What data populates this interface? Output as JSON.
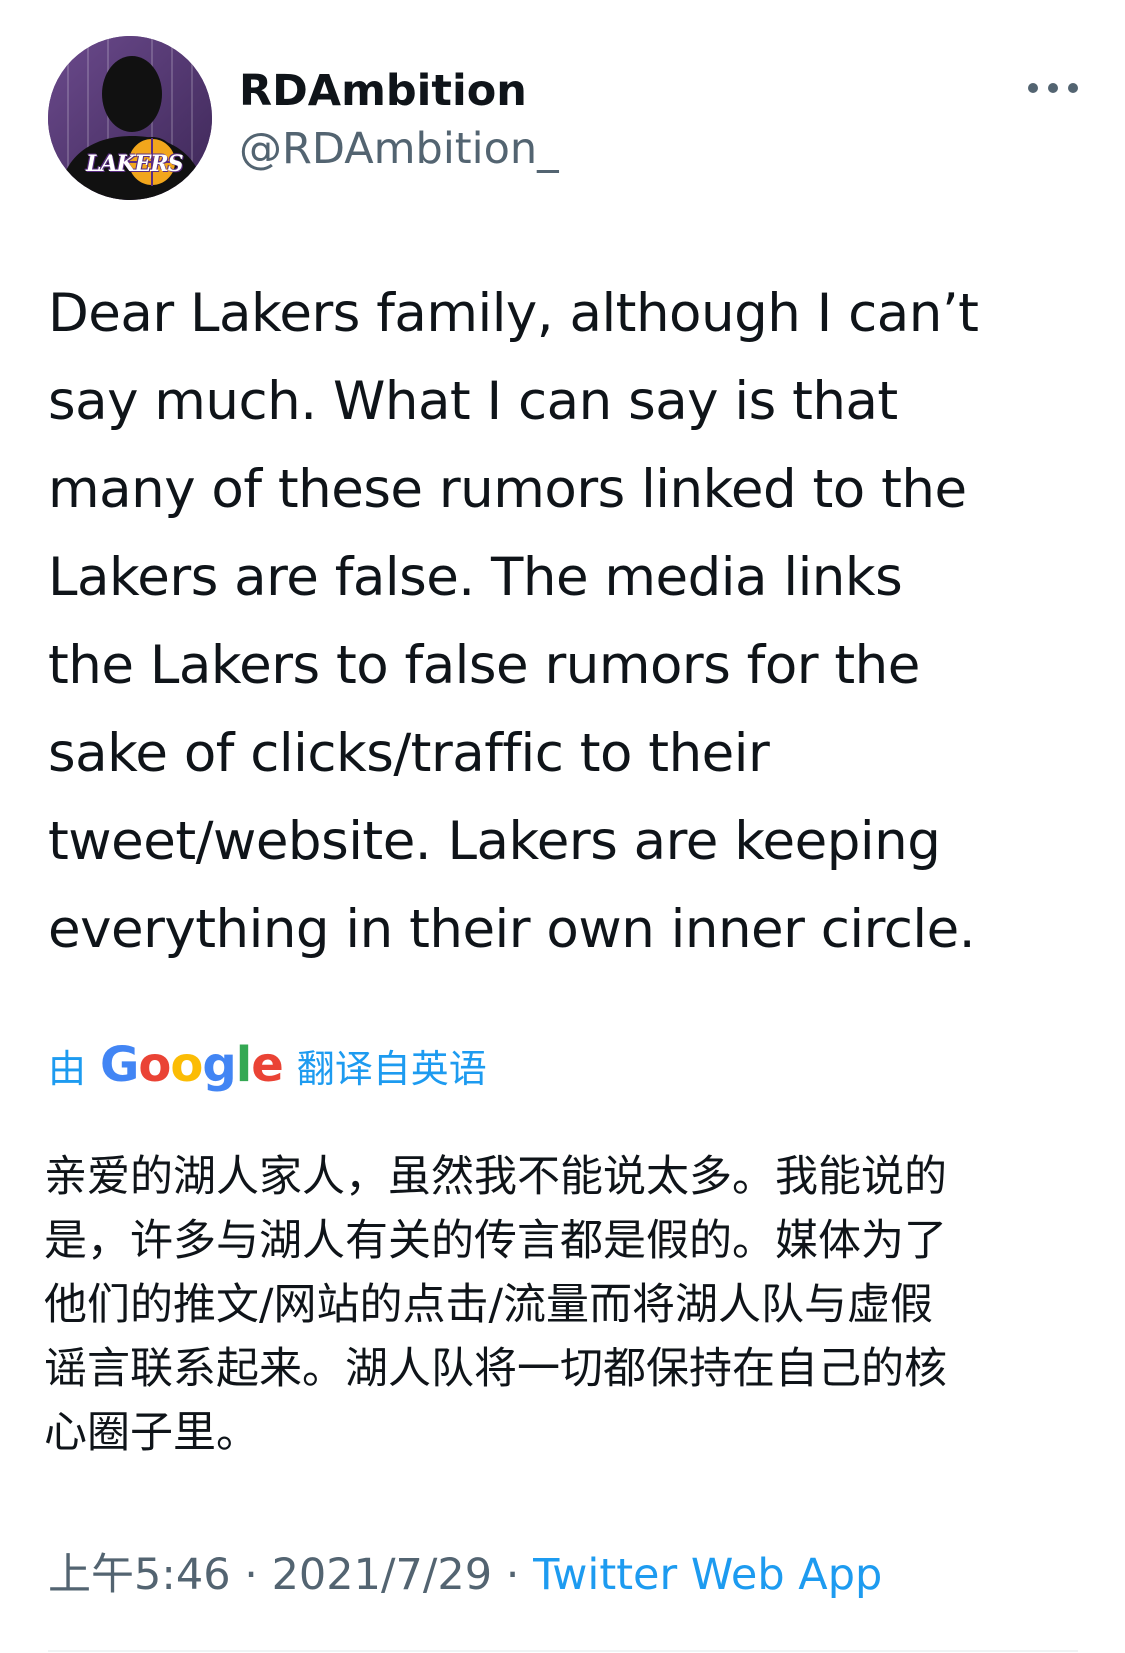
{
  "author": {
    "display_name": "RDAmbition",
    "handle": "@RDAmbition_",
    "avatar_icon": "lakers-silhouette-avatar",
    "avatar_logo_text": "LAKERS"
  },
  "menu": {
    "icon": "more-horizontal-icon"
  },
  "tweet": {
    "text": "Dear Lakers family, although I can’t\nsay much. What I can say is that\nmany of these rumors linked to the\nLakers are false. The media links\nthe Lakers to false rumors for the\nsake of clicks/traffic to their\ntweet/website. Lakers are keeping\neverything in their own inner circle."
  },
  "translation": {
    "prefix": "由",
    "provider": "Google",
    "suffix": "翻译自英语",
    "text": "亲爱的湖人家人，虽然我不能说太多。我能说的\n是，许多与湖人有关的传言都是假的。媒体为了\n他们的推文/网站的点击/流量而将湖人队与虚假\n谣言联系起来。湖人队将一切都保持在自己的核\n心圈子里。"
  },
  "meta": {
    "time": "上午5:46",
    "separator": " · ",
    "date": "2021/7/29",
    "source": "Twitter Web App"
  },
  "colors": {
    "link": "#1d9bf0",
    "secondary_text": "#536471",
    "primary_text": "#0f1419",
    "google_blue": "#4285f4",
    "google_red": "#ea4335",
    "google_yellow": "#fbbc05",
    "google_green": "#34a853"
  }
}
